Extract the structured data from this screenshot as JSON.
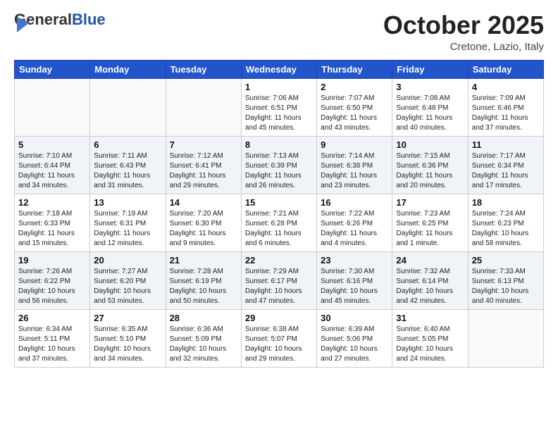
{
  "logo": {
    "general": "General",
    "blue": "Blue"
  },
  "title": "October 2025",
  "subtitle": "Cretone, Lazio, Italy",
  "weekdays": [
    "Sunday",
    "Monday",
    "Tuesday",
    "Wednesday",
    "Thursday",
    "Friday",
    "Saturday"
  ],
  "weeks": [
    [
      {
        "day": "",
        "info": ""
      },
      {
        "day": "",
        "info": ""
      },
      {
        "day": "",
        "info": ""
      },
      {
        "day": "1",
        "info": "Sunrise: 7:06 AM\nSunset: 6:51 PM\nDaylight: 11 hours and 45 minutes."
      },
      {
        "day": "2",
        "info": "Sunrise: 7:07 AM\nSunset: 6:50 PM\nDaylight: 11 hours and 43 minutes."
      },
      {
        "day": "3",
        "info": "Sunrise: 7:08 AM\nSunset: 6:48 PM\nDaylight: 11 hours and 40 minutes."
      },
      {
        "day": "4",
        "info": "Sunrise: 7:09 AM\nSunset: 6:46 PM\nDaylight: 11 hours and 37 minutes."
      }
    ],
    [
      {
        "day": "5",
        "info": "Sunrise: 7:10 AM\nSunset: 6:44 PM\nDaylight: 11 hours and 34 minutes."
      },
      {
        "day": "6",
        "info": "Sunrise: 7:11 AM\nSunset: 6:43 PM\nDaylight: 11 hours and 31 minutes."
      },
      {
        "day": "7",
        "info": "Sunrise: 7:12 AM\nSunset: 6:41 PM\nDaylight: 11 hours and 29 minutes."
      },
      {
        "day": "8",
        "info": "Sunrise: 7:13 AM\nSunset: 6:39 PM\nDaylight: 11 hours and 26 minutes."
      },
      {
        "day": "9",
        "info": "Sunrise: 7:14 AM\nSunset: 6:38 PM\nDaylight: 11 hours and 23 minutes."
      },
      {
        "day": "10",
        "info": "Sunrise: 7:15 AM\nSunset: 6:36 PM\nDaylight: 11 hours and 20 minutes."
      },
      {
        "day": "11",
        "info": "Sunrise: 7:17 AM\nSunset: 6:34 PM\nDaylight: 11 hours and 17 minutes."
      }
    ],
    [
      {
        "day": "12",
        "info": "Sunrise: 7:18 AM\nSunset: 6:33 PM\nDaylight: 11 hours and 15 minutes."
      },
      {
        "day": "13",
        "info": "Sunrise: 7:19 AM\nSunset: 6:31 PM\nDaylight: 11 hours and 12 minutes."
      },
      {
        "day": "14",
        "info": "Sunrise: 7:20 AM\nSunset: 6:30 PM\nDaylight: 11 hours and 9 minutes."
      },
      {
        "day": "15",
        "info": "Sunrise: 7:21 AM\nSunset: 6:28 PM\nDaylight: 11 hours and 6 minutes."
      },
      {
        "day": "16",
        "info": "Sunrise: 7:22 AM\nSunset: 6:26 PM\nDaylight: 11 hours and 4 minutes."
      },
      {
        "day": "17",
        "info": "Sunrise: 7:23 AM\nSunset: 6:25 PM\nDaylight: 11 hours and 1 minute."
      },
      {
        "day": "18",
        "info": "Sunrise: 7:24 AM\nSunset: 6:23 PM\nDaylight: 10 hours and 58 minutes."
      }
    ],
    [
      {
        "day": "19",
        "info": "Sunrise: 7:26 AM\nSunset: 6:22 PM\nDaylight: 10 hours and 56 minutes."
      },
      {
        "day": "20",
        "info": "Sunrise: 7:27 AM\nSunset: 6:20 PM\nDaylight: 10 hours and 53 minutes."
      },
      {
        "day": "21",
        "info": "Sunrise: 7:28 AM\nSunset: 6:19 PM\nDaylight: 10 hours and 50 minutes."
      },
      {
        "day": "22",
        "info": "Sunrise: 7:29 AM\nSunset: 6:17 PM\nDaylight: 10 hours and 47 minutes."
      },
      {
        "day": "23",
        "info": "Sunrise: 7:30 AM\nSunset: 6:16 PM\nDaylight: 10 hours and 45 minutes."
      },
      {
        "day": "24",
        "info": "Sunrise: 7:32 AM\nSunset: 6:14 PM\nDaylight: 10 hours and 42 minutes."
      },
      {
        "day": "25",
        "info": "Sunrise: 7:33 AM\nSunset: 6:13 PM\nDaylight: 10 hours and 40 minutes."
      }
    ],
    [
      {
        "day": "26",
        "info": "Sunrise: 6:34 AM\nSunset: 5:11 PM\nDaylight: 10 hours and 37 minutes."
      },
      {
        "day": "27",
        "info": "Sunrise: 6:35 AM\nSunset: 5:10 PM\nDaylight: 10 hours and 34 minutes."
      },
      {
        "day": "28",
        "info": "Sunrise: 6:36 AM\nSunset: 5:09 PM\nDaylight: 10 hours and 32 minutes."
      },
      {
        "day": "29",
        "info": "Sunrise: 6:38 AM\nSunset: 5:07 PM\nDaylight: 10 hours and 29 minutes."
      },
      {
        "day": "30",
        "info": "Sunrise: 6:39 AM\nSunset: 5:06 PM\nDaylight: 10 hours and 27 minutes."
      },
      {
        "day": "31",
        "info": "Sunrise: 6:40 AM\nSunset: 5:05 PM\nDaylight: 10 hours and 24 minutes."
      },
      {
        "day": "",
        "info": ""
      }
    ]
  ]
}
